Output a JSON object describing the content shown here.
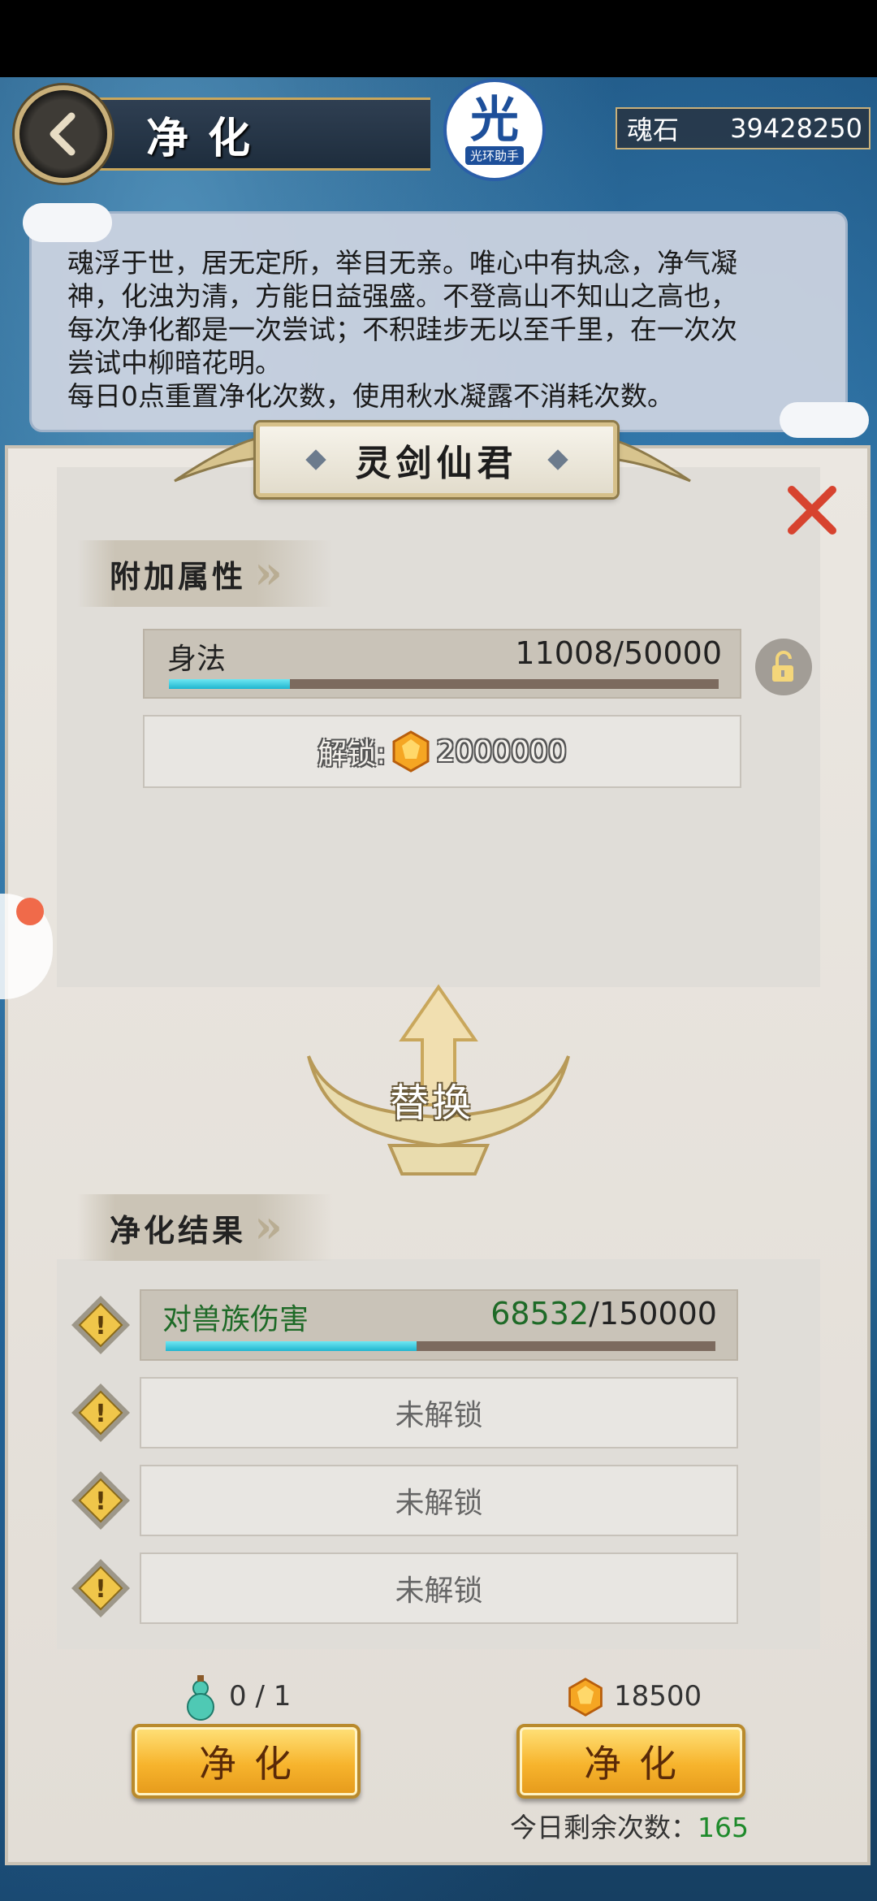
{
  "header": {
    "title": "净化",
    "logo_main": "光",
    "logo_sub": "光环助手",
    "currency_name": "魂石",
    "currency_value": "39428250"
  },
  "description": [
    "魂浮于世，居无定所，举目无亲。唯心中有执念，净气凝",
    "神，化浊为清，方能日益强盛。不登高山不知山之高也，",
    "每次净化都是一次尝试；不积跬步无以至千里，在一次次",
    "尝试中柳暗花明。",
    "每日0点重置净化次数，使用秋水凝露不消耗次数。"
  ],
  "character_name": "灵剑仙君",
  "sections": {
    "extra_attr": "附加属性",
    "result": "净化结果"
  },
  "attribute": {
    "name": "身法",
    "value_text": "11008/50000",
    "fill": 0.22
  },
  "unlock": {
    "label": "解锁:",
    "cost": "2000000"
  },
  "replace_label": "替换",
  "results": [
    {
      "name": "对兽族伤害",
      "current": "68532",
      "max": "/150000",
      "fill": 0.457
    },
    {
      "locked_label": "未解锁"
    },
    {
      "locked_label": "未解锁"
    },
    {
      "locked_label": "未解锁"
    }
  ],
  "bottom": {
    "item_count": "0 / 1",
    "gem_cost": "18500",
    "purify_label": "净化",
    "remaining_label": "今日剩余次数：",
    "remaining_value": "165"
  }
}
